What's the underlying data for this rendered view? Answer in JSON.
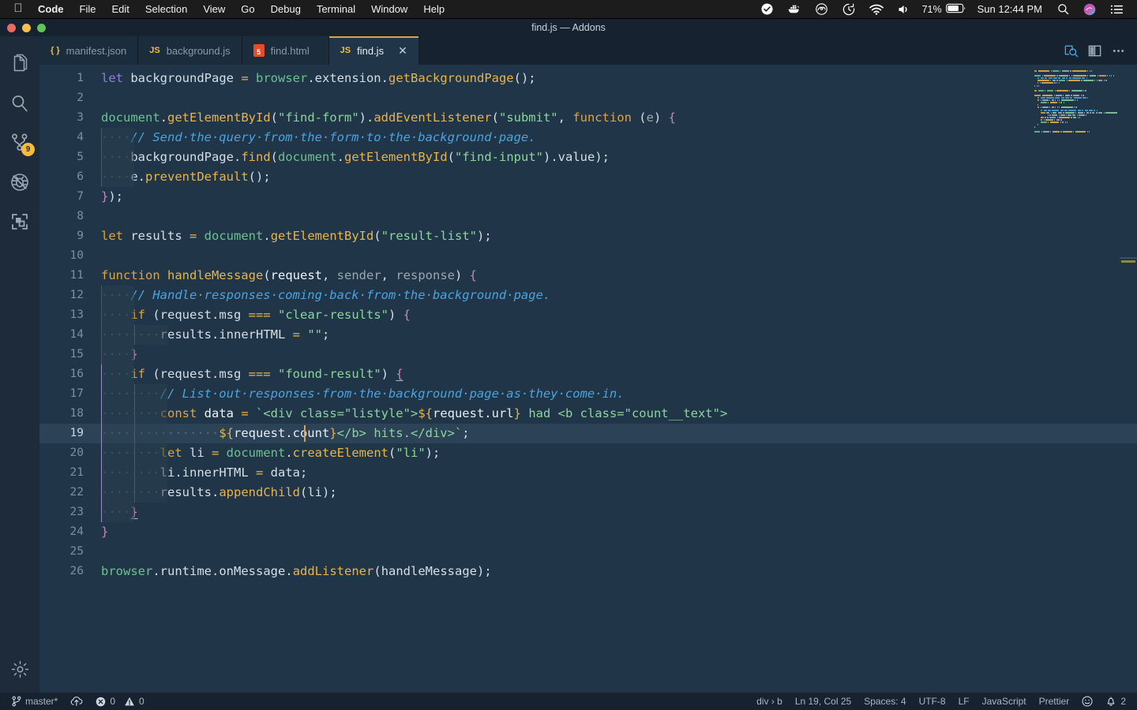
{
  "menubar": {
    "apple_icon": "apple-icon",
    "items": [
      {
        "label": "Code",
        "bold": true
      },
      {
        "label": "File",
        "bold": false
      },
      {
        "label": "Edit",
        "bold": false
      },
      {
        "label": "Selection",
        "bold": false
      },
      {
        "label": "View",
        "bold": false
      },
      {
        "label": "Go",
        "bold": false
      },
      {
        "label": "Debug",
        "bold": false
      },
      {
        "label": "Terminal",
        "bold": false
      },
      {
        "label": "Window",
        "bold": false
      },
      {
        "label": "Help",
        "bold": false
      }
    ],
    "right": {
      "icons": [
        "checkmark-circle-icon",
        "docker-icon",
        "creative-cloud-icon",
        "time-machine-icon",
        "wifi-icon",
        "volume-icon"
      ],
      "battery_percent": "71%",
      "battery_icon": "battery-icon",
      "clock": "Sun 12:44 PM",
      "search_icon": "spotlight-search-icon",
      "siri_icon": "siri-icon",
      "control_center_icon": "notification-center-icon"
    }
  },
  "window": {
    "title": "find.js — Addons",
    "traffic_lights": [
      "close-button",
      "minimize-button",
      "maximize-button"
    ]
  },
  "activitybar": {
    "items": [
      {
        "name": "explorer",
        "icon": "files-icon",
        "badge": null
      },
      {
        "name": "search",
        "icon": "search-icon",
        "badge": null
      },
      {
        "name": "source-control",
        "icon": "source-control-icon",
        "badge": "9"
      },
      {
        "name": "debug",
        "icon": "debug-icon",
        "badge": null
      },
      {
        "name": "extensions",
        "icon": "extensions-icon",
        "badge": null
      }
    ],
    "bottom": [
      {
        "name": "manage",
        "icon": "gear-icon"
      }
    ]
  },
  "tabs": [
    {
      "label": "manifest.json",
      "icon": "json-icon",
      "icon_text": "{ }",
      "active": false,
      "closable": false
    },
    {
      "label": "background.js",
      "icon": "js-icon",
      "icon_text": "JS",
      "active": false,
      "closable": false
    },
    {
      "label": "find.html",
      "icon": "html5-icon",
      "icon_text": "5",
      "active": false,
      "closable": false
    },
    {
      "label": "find.js",
      "icon": "js-icon",
      "icon_text": "JS",
      "active": true,
      "closable": true
    }
  ],
  "tab_close_glyph": "✕",
  "editor_actions": [
    {
      "name": "open-preview-button",
      "icon": "preview-icon"
    },
    {
      "name": "split-editor-button",
      "icon": "split-editor-icon"
    },
    {
      "name": "more-actions-button",
      "icon": "ellipsis-icon"
    }
  ],
  "editor": {
    "filename": "find.js",
    "language": "JavaScript",
    "cursor_line": 19,
    "cursor_col": 25,
    "lines": [
      {
        "n": 1,
        "text": "let backgroundPage = browser.extension.getBackgroundPage();"
      },
      {
        "n": 2,
        "text": ""
      },
      {
        "n": 3,
        "text": "document.getElementById(\"find-form\").addEventListener(\"submit\", function (e) {"
      },
      {
        "n": 4,
        "text": "    // Send the query from the form to the background page."
      },
      {
        "n": 5,
        "text": "    backgroundPage.find(document.getElementById(\"find-input\").value);"
      },
      {
        "n": 6,
        "text": "    e.preventDefault();"
      },
      {
        "n": 7,
        "text": "});"
      },
      {
        "n": 8,
        "text": ""
      },
      {
        "n": 9,
        "text": "let results = document.getElementById(\"result-list\");"
      },
      {
        "n": 10,
        "text": ""
      },
      {
        "n": 11,
        "text": "function handleMessage(request, sender, response) {"
      },
      {
        "n": 12,
        "text": "    // Handle responses coming back from the background page."
      },
      {
        "n": 13,
        "text": "    if (request.msg === \"clear-results\") {"
      },
      {
        "n": 14,
        "text": "        results.innerHTML = \"\";"
      },
      {
        "n": 15,
        "text": "    }"
      },
      {
        "n": 16,
        "text": "    if (request.msg === \"found-result\") {"
      },
      {
        "n": 17,
        "text": "        // List out responses from the background page as they come in."
      },
      {
        "n": 18,
        "text": "        const data = `<div class=\"listyle\">${request.url} had <b class=\"count__text\">"
      },
      {
        "n": 19,
        "text": "                ${request.count}</b> hits.</div>`;"
      },
      {
        "n": 20,
        "text": "        let li = document.createElement(\"li\");"
      },
      {
        "n": 21,
        "text": "        li.innerHTML = data;"
      },
      {
        "n": 22,
        "text": "        results.appendChild(li);"
      },
      {
        "n": 23,
        "text": "    }"
      },
      {
        "n": 24,
        "text": "}"
      },
      {
        "n": 25,
        "text": ""
      },
      {
        "n": 26,
        "text": "browser.runtime.onMessage.addListener(handleMessage);"
      }
    ]
  },
  "statusbar": {
    "left": [
      {
        "name": "branch",
        "icon": "source-control-icon",
        "label": "master*"
      },
      {
        "name": "sync",
        "icon": "sync-cloud-icon",
        "label": ""
      },
      {
        "name": "errors",
        "icon": "error-icon",
        "label": "0"
      },
      {
        "name": "warnings",
        "icon": "warning-icon",
        "label": "0"
      }
    ],
    "right": [
      {
        "name": "breadcrumb-selector",
        "label": "div › b"
      },
      {
        "name": "cursor-position",
        "label": "Ln 19, Col 25"
      },
      {
        "name": "indentation",
        "label": "Spaces: 4"
      },
      {
        "name": "encoding",
        "label": "UTF-8"
      },
      {
        "name": "eol",
        "label": "LF"
      },
      {
        "name": "language-mode",
        "label": "JavaScript"
      },
      {
        "name": "formatter",
        "label": "Prettier"
      },
      {
        "name": "feedback",
        "icon": "smiley-icon",
        "label": ""
      },
      {
        "name": "notifications",
        "icon": "bell-icon",
        "label": "2"
      }
    ]
  },
  "colors": {
    "editor_bg": "#203648",
    "activity_bg": "#1d2b3a",
    "titlebar_bg": "#16222f",
    "accent": "#e0a33e",
    "badge": "#f7bd3a",
    "active_line": "#2b4257"
  }
}
